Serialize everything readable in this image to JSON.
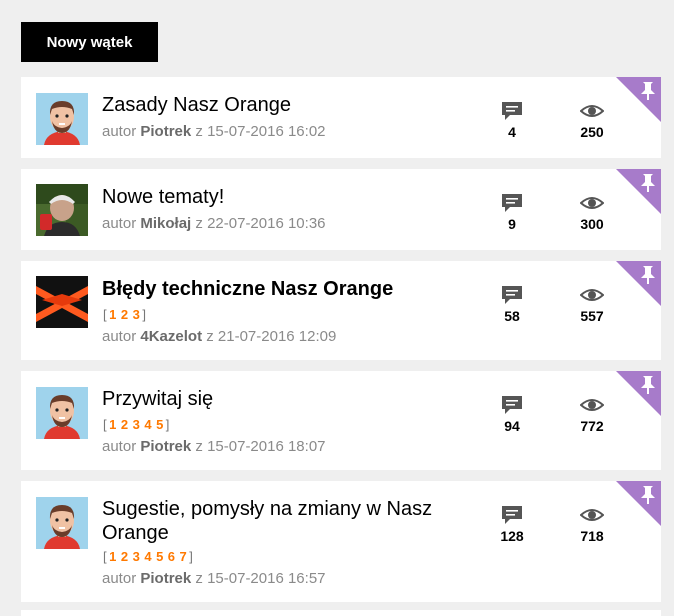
{
  "toolbar": {
    "new_thread_label": "Nowy wątek"
  },
  "colors": {
    "accent": "#ff7900",
    "pin": "#a77bca",
    "icon": "#555555"
  },
  "threads": [
    {
      "title": "Zasady Nasz Orange",
      "bold": false,
      "pages": [],
      "author_prefix": "autor",
      "author": "Piotrek",
      "date": "z 15-07-2016 16:02",
      "comments": "4",
      "views": "250",
      "pinned": true,
      "avatar": "cartoon-man-avatar"
    },
    {
      "title": "Nowe tematy!",
      "bold": false,
      "pages": [],
      "author_prefix": "autor",
      "author": "Mikołaj",
      "date": "z 22-07-2016 10:36",
      "comments": "9",
      "views": "300",
      "pinned": true,
      "avatar": "cyclist-photo-avatar"
    },
    {
      "title": "Błędy techniczne Nasz Orange",
      "bold": true,
      "pages": [
        "1",
        "2",
        "3"
      ],
      "author_prefix": "autor",
      "author": "4Kazelot",
      "date": "z 21-07-2016 12:09",
      "comments": "58",
      "views": "557",
      "pinned": true,
      "avatar": "orange-logo-avatar"
    },
    {
      "title": "Przywitaj się",
      "bold": false,
      "pages": [
        "1",
        "2",
        "3",
        "4",
        "5"
      ],
      "author_prefix": "autor",
      "author": "Piotrek",
      "date": "z 15-07-2016 18:07",
      "comments": "94",
      "views": "772",
      "pinned": true,
      "avatar": "cartoon-man-avatar"
    },
    {
      "title": "Sugestie, pomysły na zmiany w Nasz Orange",
      "bold": false,
      "pages": [
        "1",
        "2",
        "3",
        "4",
        "5",
        "6",
        "7"
      ],
      "author_prefix": "autor",
      "author": "Piotrek",
      "date": "z 15-07-2016 16:57",
      "comments": "128",
      "views": "718",
      "pinned": true,
      "avatar": "cartoon-man-avatar"
    }
  ]
}
